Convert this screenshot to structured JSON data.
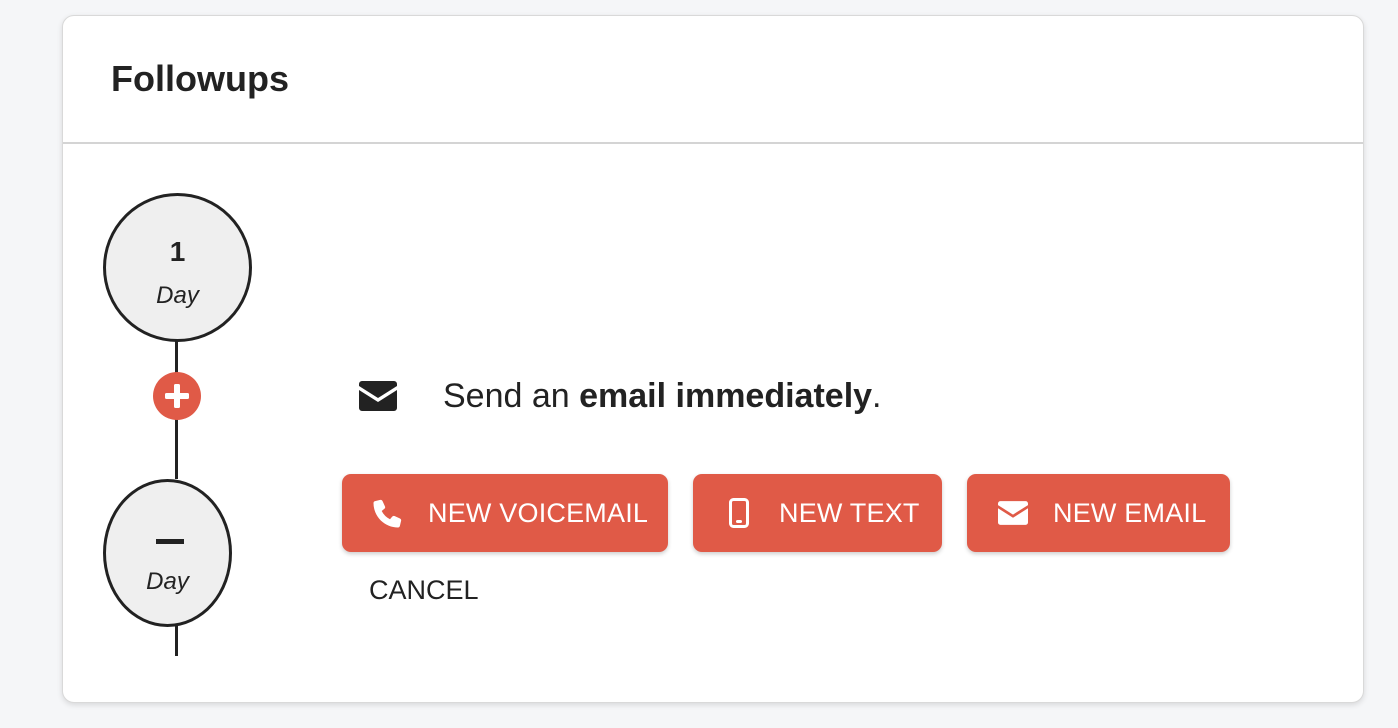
{
  "header": {
    "title": "Followups"
  },
  "timeline": {
    "nodes": [
      {
        "value": "1",
        "unit": "Day"
      },
      {
        "value": "",
        "unit": "Day",
        "icon": "minus-icon"
      }
    ],
    "add_icon": "plus-icon"
  },
  "step": {
    "icon": "envelope-icon",
    "text_prefix": "Send an ",
    "text_bold": "email immediately",
    "text_suffix": "."
  },
  "actions": {
    "voicemail": {
      "label": "NEW VOICEMAIL",
      "icon": "phone-icon"
    },
    "text": {
      "label": "NEW TEXT",
      "icon": "mobile-icon"
    },
    "email": {
      "label": "NEW EMAIL",
      "icon": "envelope-icon"
    },
    "cancel": "CANCEL"
  },
  "colors": {
    "accent": "#e05a47",
    "node_fill": "#efefef",
    "text": "#222222"
  }
}
